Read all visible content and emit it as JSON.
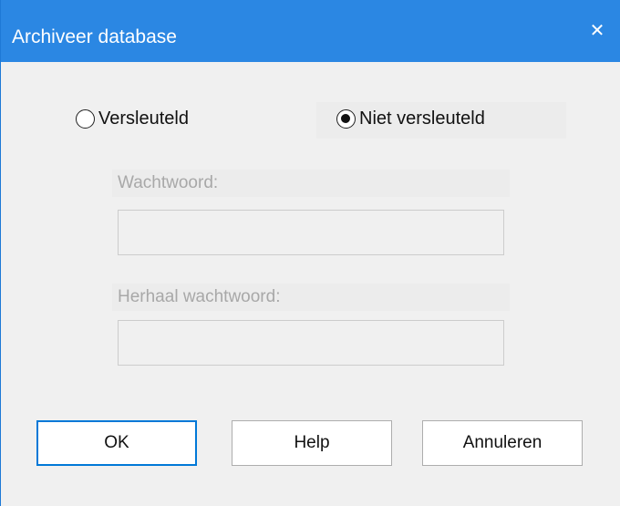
{
  "window": {
    "title": "Archiveer database",
    "close_glyph": "✕",
    "accent_color": "#2b87e3"
  },
  "encryption": {
    "options": [
      {
        "label": "Versleuteld",
        "selected": false
      },
      {
        "label": "Niet versleuteld",
        "selected": true
      }
    ]
  },
  "fields": {
    "password_label": "Wachtwoord:",
    "password_value": "",
    "repeat_label": "Herhaal wachtwoord:",
    "repeat_value": "",
    "enabled": false
  },
  "buttons": {
    "ok": "OK",
    "help": "Help",
    "cancel": "Annuleren"
  }
}
